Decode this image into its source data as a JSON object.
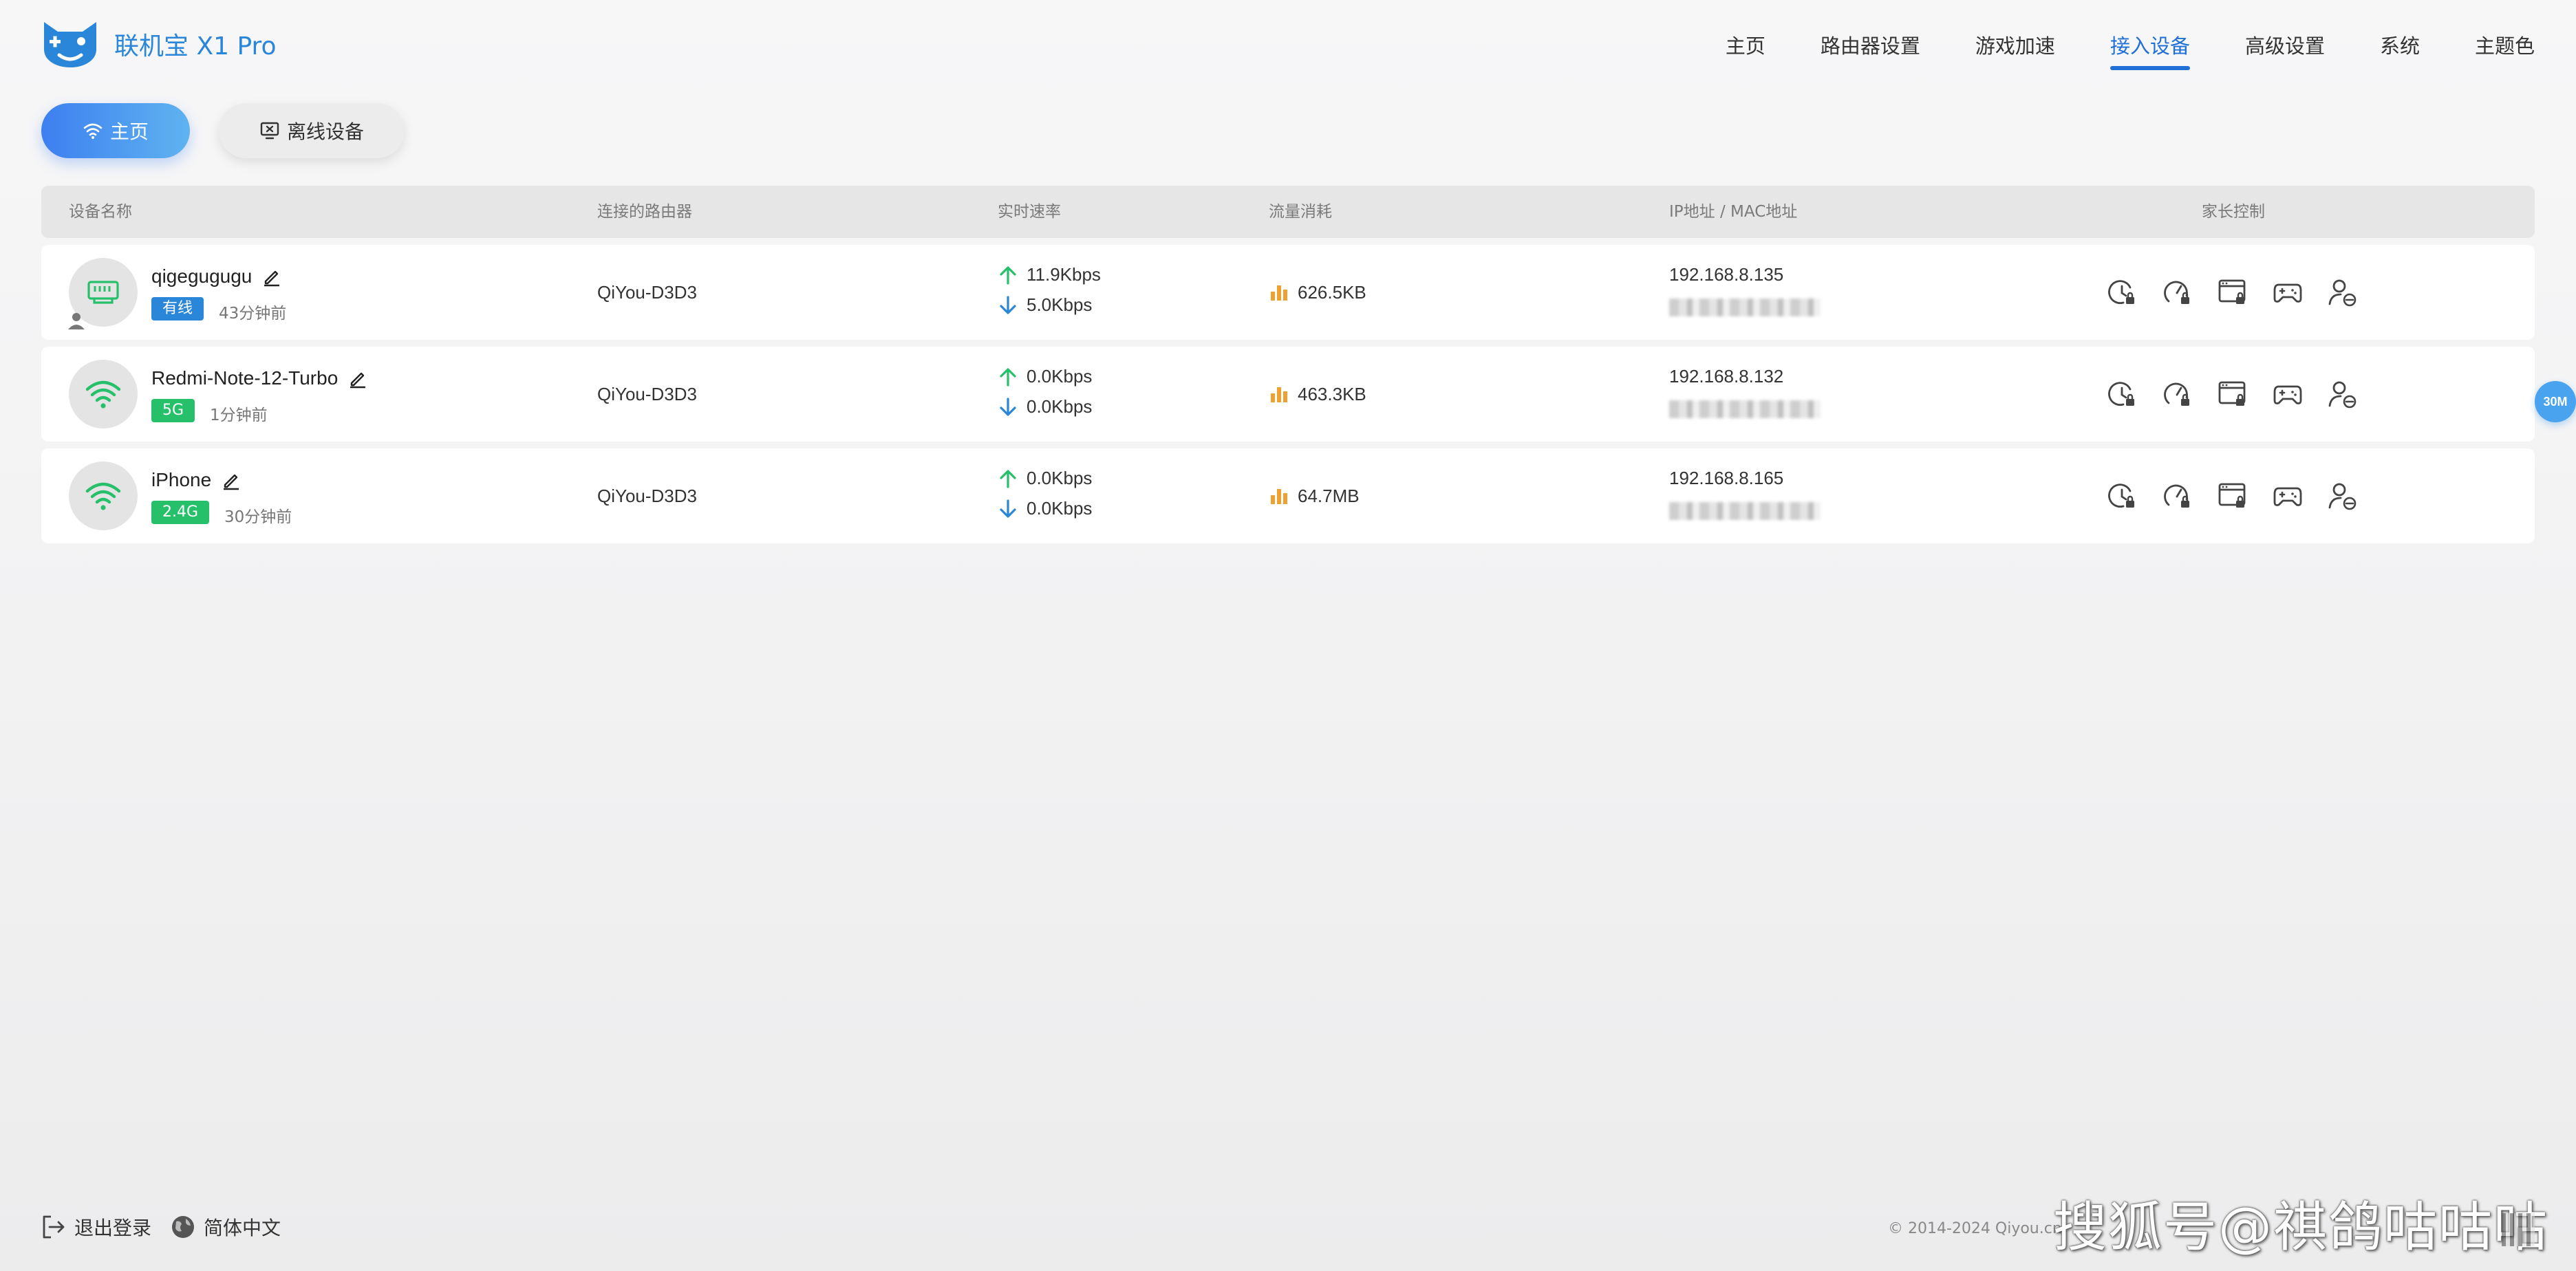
{
  "app": {
    "title": "联机宝 X1 Pro",
    "accent_color": "#2a86d8",
    "active_color": "#1f6fd6"
  },
  "nav": {
    "items": [
      {
        "label": "主页",
        "active": false
      },
      {
        "label": "路由器设置",
        "active": false
      },
      {
        "label": "游戏加速",
        "active": false
      },
      {
        "label": "接入设备",
        "active": true
      },
      {
        "label": "高级设置",
        "active": false
      },
      {
        "label": "系统",
        "active": false
      },
      {
        "label": "主题色",
        "active": false
      }
    ]
  },
  "filters": {
    "home_label": "主页",
    "offline_label": "离线设备"
  },
  "table": {
    "headers": {
      "device": "设备名称",
      "router": "连接的路由器",
      "speed": "实时速率",
      "traffic": "流量消耗",
      "address": "IP地址 / MAC地址",
      "parental": "家长控制"
    },
    "rows": [
      {
        "name": "qigegugugu",
        "type_icon": "ethernet-icon",
        "tag": "有线",
        "tag_color": "#2a86d8",
        "online_time": "43分钟前",
        "router": "QiYou-D3D3",
        "upload": "11.9Kbps",
        "download": "5.0Kbps",
        "traffic": "626.5KB",
        "ip": "192.168.8.135"
      },
      {
        "name": "Redmi-Note-12-Turbo",
        "type_icon": "wifi-icon",
        "tag": "5G",
        "tag_color": "#27c06a",
        "online_time": "1分钟前",
        "router": "QiYou-D3D3",
        "upload": "0.0Kbps",
        "download": "0.0Kbps",
        "traffic": "463.3KB",
        "ip": "192.168.8.132"
      },
      {
        "name": "iPhone",
        "type_icon": "wifi-icon",
        "tag": "2.4G",
        "tag_color": "#27c06a",
        "online_time": "30分钟前",
        "router": "QiYou-D3D3",
        "upload": "0.0Kbps",
        "download": "0.0Kbps",
        "traffic": "64.7MB",
        "ip": "192.168.8.165"
      }
    ]
  },
  "side_badge": "30M",
  "footer": {
    "logout": "退出登录",
    "language": "简体中文",
    "copyright": "© 2014-2024 Qiyou.cn"
  },
  "watermark": "搜狐号@祺鸽咕咕咕"
}
